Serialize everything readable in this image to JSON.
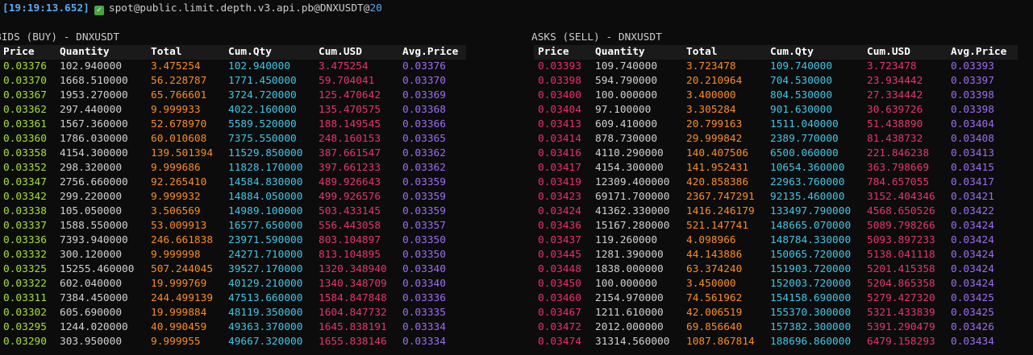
{
  "header": {
    "timestamp": "[19:19:13.652]",
    "stream_prefix": "spot@public.limit.depth.v3.api.pb@DNXUSDT@",
    "stream_suffix": "20"
  },
  "bids": {
    "title": "BIDS (BUY) - DNXUSDT",
    "columns": [
      "Price",
      "Quantity",
      "Total",
      "Cum.Qty",
      "Cum.USD",
      "Avg.Price"
    ],
    "rows": [
      [
        "0.03376",
        "102.940000",
        "3.475254",
        "102.940000",
        "3.475254",
        "0.03376"
      ],
      [
        "0.03370",
        "1668.510000",
        "56.228787",
        "1771.450000",
        "59.704041",
        "0.03370"
      ],
      [
        "0.03367",
        "1953.270000",
        "65.766601",
        "3724.720000",
        "125.470642",
        "0.03369"
      ],
      [
        "0.03362",
        "297.440000",
        "9.999933",
        "4022.160000",
        "135.470575",
        "0.03368"
      ],
      [
        "0.03361",
        "1567.360000",
        "52.678970",
        "5589.520000",
        "188.149545",
        "0.03366"
      ],
      [
        "0.03360",
        "1786.030000",
        "60.010608",
        "7375.550000",
        "248.160153",
        "0.03365"
      ],
      [
        "0.03358",
        "4154.300000",
        "139.501394",
        "11529.850000",
        "387.661547",
        "0.03362"
      ],
      [
        "0.03352",
        "298.320000",
        "9.999686",
        "11828.170000",
        "397.661233",
        "0.03362"
      ],
      [
        "0.03347",
        "2756.660000",
        "92.265410",
        "14584.830000",
        "489.926643",
        "0.03359"
      ],
      [
        "0.03342",
        "299.220000",
        "9.999932",
        "14884.050000",
        "499.926576",
        "0.03359"
      ],
      [
        "0.03338",
        "105.050000",
        "3.506569",
        "14989.100000",
        "503.433145",
        "0.03359"
      ],
      [
        "0.03337",
        "1588.550000",
        "53.009913",
        "16577.650000",
        "556.443058",
        "0.03357"
      ],
      [
        "0.03336",
        "7393.940000",
        "246.661838",
        "23971.590000",
        "803.104897",
        "0.03350"
      ],
      [
        "0.03332",
        "300.120000",
        "9.999998",
        "24271.710000",
        "813.104895",
        "0.03350"
      ],
      [
        "0.03325",
        "15255.460000",
        "507.244045",
        "39527.170000",
        "1320.348940",
        "0.03340"
      ],
      [
        "0.03322",
        "602.040000",
        "19.999769",
        "40129.210000",
        "1340.348709",
        "0.03340"
      ],
      [
        "0.03311",
        "7384.450000",
        "244.499139",
        "47513.660000",
        "1584.847848",
        "0.03336"
      ],
      [
        "0.03302",
        "605.690000",
        "19.999884",
        "48119.350000",
        "1604.847732",
        "0.03335"
      ],
      [
        "0.03295",
        "1244.020000",
        "40.990459",
        "49363.370000",
        "1645.838191",
        "0.03334"
      ],
      [
        "0.03290",
        "303.950000",
        "9.999955",
        "49667.320000",
        "1655.838146",
        "0.03334"
      ]
    ]
  },
  "asks": {
    "title": "ASKS (SELL) - DNXUSDT",
    "columns": [
      "Price",
      "Quantity",
      "Total",
      "Cum.Qty",
      "Cum.USD",
      "Avg.Price"
    ],
    "rows": [
      [
        "0.03393",
        "109.740000",
        "3.723478",
        "109.740000",
        "3.723478",
        "0.03393"
      ],
      [
        "0.03398",
        "594.790000",
        "20.210964",
        "704.530000",
        "23.934442",
        "0.03397"
      ],
      [
        "0.03400",
        "100.000000",
        "3.400000",
        "804.530000",
        "27.334442",
        "0.03398"
      ],
      [
        "0.03404",
        "97.100000",
        "3.305284",
        "901.630000",
        "30.639726",
        "0.03398"
      ],
      [
        "0.03413",
        "609.410000",
        "20.799163",
        "1511.040000",
        "51.438890",
        "0.03404"
      ],
      [
        "0.03414",
        "878.730000",
        "29.999842",
        "2389.770000",
        "81.438732",
        "0.03408"
      ],
      [
        "0.03416",
        "4110.290000",
        "140.407506",
        "6500.060000",
        "221.846238",
        "0.03413"
      ],
      [
        "0.03417",
        "4154.300000",
        "141.952431",
        "10654.360000",
        "363.798669",
        "0.03415"
      ],
      [
        "0.03419",
        "12309.400000",
        "420.858386",
        "22963.760000",
        "784.657055",
        "0.03417"
      ],
      [
        "0.03423",
        "69171.700000",
        "2367.747291",
        "92135.460000",
        "3152.404346",
        "0.03421"
      ],
      [
        "0.03424",
        "41362.330000",
        "1416.246179",
        "133497.790000",
        "4568.650526",
        "0.03422"
      ],
      [
        "0.03436",
        "15167.280000",
        "521.147741",
        "148665.070000",
        "5089.798266",
        "0.03424"
      ],
      [
        "0.03437",
        "119.260000",
        "4.098966",
        "148784.330000",
        "5093.897233",
        "0.03424"
      ],
      [
        "0.03445",
        "1281.390000",
        "44.143886",
        "150065.720000",
        "5138.041118",
        "0.03424"
      ],
      [
        "0.03448",
        "1838.000000",
        "63.374240",
        "151903.720000",
        "5201.415358",
        "0.03424"
      ],
      [
        "0.03450",
        "100.000000",
        "3.450000",
        "152003.720000",
        "5204.865358",
        "0.03424"
      ],
      [
        "0.03460",
        "2154.970000",
        "74.561962",
        "154158.690000",
        "5279.427320",
        "0.03425"
      ],
      [
        "0.03467",
        "1211.610000",
        "42.006519",
        "155370.300000",
        "5321.433839",
        "0.03425"
      ],
      [
        "0.03472",
        "2012.000000",
        "69.856640",
        "157382.300000",
        "5391.290479",
        "0.03426"
      ],
      [
        "0.03474",
        "31314.560000",
        "1087.867814",
        "188696.860000",
        "6479.158293",
        "0.03434"
      ]
    ]
  },
  "colors": {
    "background": "#0c0c0c",
    "timestamp": "#5aa9f4",
    "bid_price": "#a6e22e",
    "ask_price": "#f2296e",
    "quantity": "#d0d0d0",
    "total": "#fd8c1c",
    "cum_qty": "#3ec7e8",
    "cum_usd": "#e8336e",
    "avg_price": "#9d6cf5"
  },
  "icons": {
    "status": "check-icon"
  }
}
